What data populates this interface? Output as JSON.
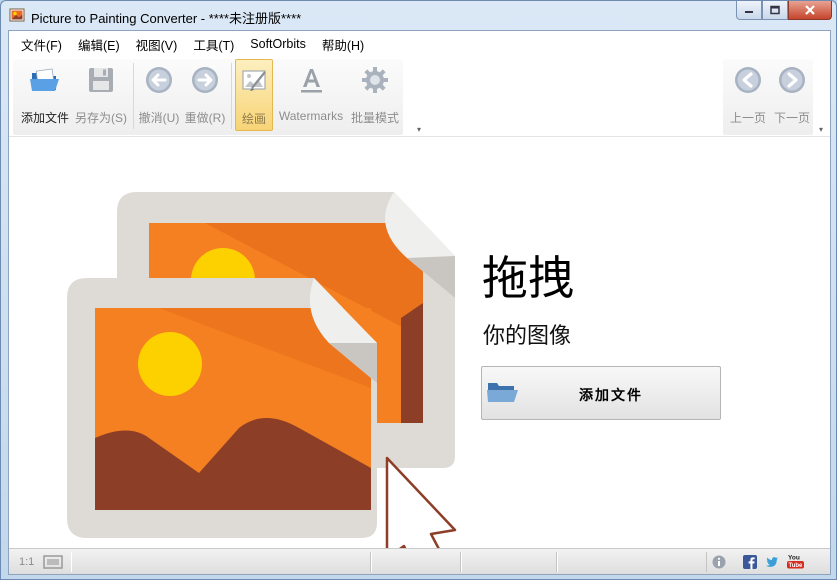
{
  "window": {
    "title": "Picture to Painting Converter - ****未注册版****"
  },
  "menu": {
    "items": [
      "文件(F)",
      "编辑(E)",
      "视图(V)",
      "工具(T)",
      "SoftOrbits",
      "帮助(H)"
    ]
  },
  "toolbar": {
    "add_file": "添加文件",
    "save_as": "另存为(S)",
    "undo": "撤消(U)",
    "redo": "重做(R)",
    "paint": "绘画",
    "watermarks": "Watermarks",
    "batch_mode": "批量模式",
    "prev_page": "上一页",
    "next_page": "下一页"
  },
  "main": {
    "drag_title": "拖拽",
    "drag_subtitle": "你的图像",
    "add_file_button": "添加文件"
  },
  "status": {
    "zoom": "1:1"
  },
  "colors": {
    "accent_orange": "#f58021",
    "sun_yellow": "#fdd000",
    "mountain_brown": "#8c3e26",
    "frame_gray": "#dedad6",
    "active_tab": "#f7d476"
  }
}
